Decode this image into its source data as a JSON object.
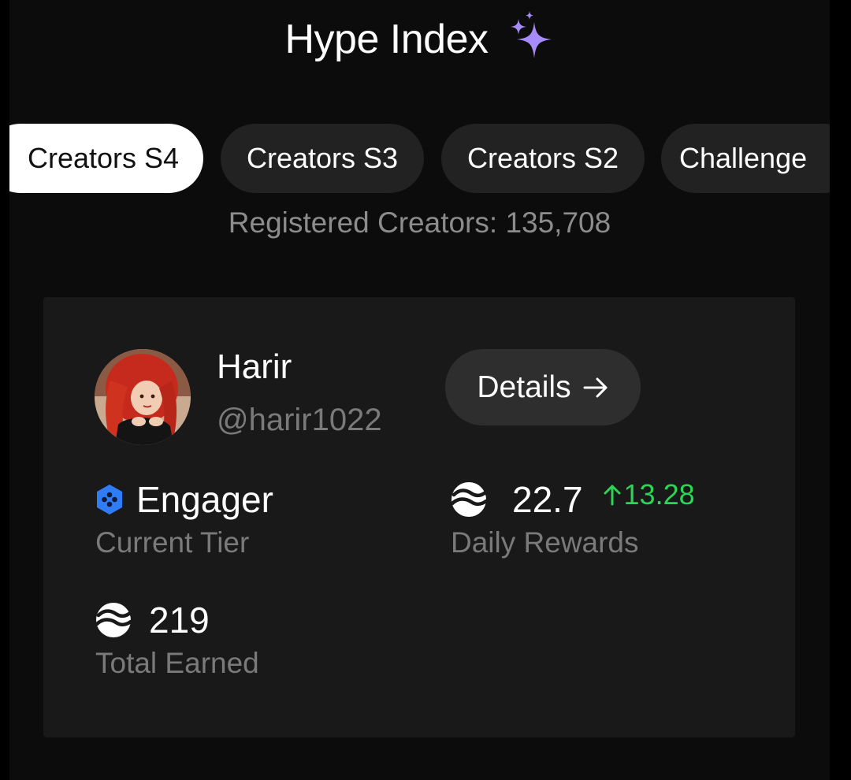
{
  "header": {
    "title": "Hype Index",
    "sparkle_icon": "sparkles-icon",
    "accent_color": "#a78bfa"
  },
  "tabs": [
    {
      "label": "Creators S4",
      "active": true
    },
    {
      "label": "Creators S3",
      "active": false
    },
    {
      "label": "Creators S2",
      "active": false
    },
    {
      "label": "Challenge",
      "active": false
    }
  ],
  "registered_text": "Registered Creators: 135,708",
  "profile": {
    "name": "Harir",
    "handle": "@harir1022",
    "details_label": "Details",
    "details_icon": "arrow-right-icon"
  },
  "stats": {
    "tier": {
      "value": "Engager",
      "label": "Current Tier",
      "icon": "hexagon-badge-icon",
      "icon_color": "#2f7cf6"
    },
    "daily": {
      "value": "22.7",
      "change": "13.28",
      "change_icon": "arrow-up-icon",
      "change_color": "#2bd657",
      "label": "Daily Rewards",
      "icon": "coin-icon"
    },
    "total": {
      "value": "219",
      "label": "Total Earned",
      "icon": "coin-icon"
    }
  }
}
